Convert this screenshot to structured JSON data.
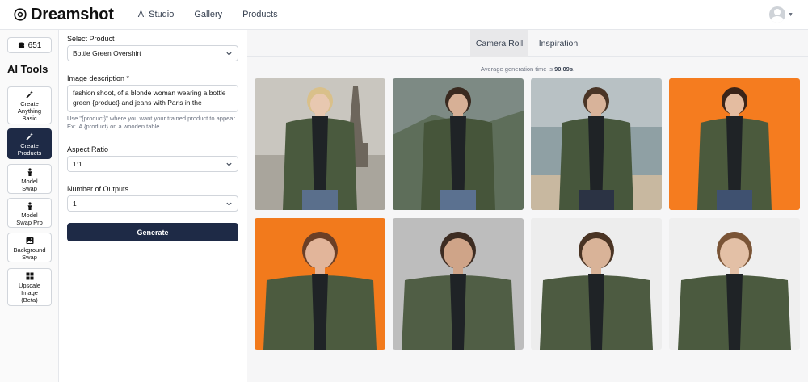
{
  "brand": {
    "name": "Dreamshot"
  },
  "nav": {
    "items": [
      "AI Studio",
      "Gallery",
      "Products"
    ]
  },
  "sidebar": {
    "credits": "651",
    "title": "AI Tools",
    "tools": [
      {
        "label": "Create\nAnything\nBasic",
        "icon": "magic-wand-icon",
        "active": false
      },
      {
        "label": "Create\nProducts",
        "icon": "magic-wand-icon",
        "active": true
      },
      {
        "label": "Model\nSwap",
        "icon": "person-icon",
        "active": false
      },
      {
        "label": "Model\nSwap Pro",
        "icon": "person-icon",
        "active": false
      },
      {
        "label": "Background\nSwap",
        "icon": "image-icon",
        "active": false
      },
      {
        "label": "Upscale\nImage\n(Beta)",
        "icon": "grid-icon",
        "active": false
      }
    ]
  },
  "form": {
    "product_label": "Select Product",
    "product_value": "Bottle Green Overshirt",
    "description_label": "Image description *",
    "description_value": "fashion shoot, of a blonde woman wearing a bottle green {product} and jeans with Paris in the",
    "hint": "Use \"{product}\" where you want your trained product to appear. Ex: 'A {product} on a wooden table.",
    "aspect_label": "Aspect Ratio",
    "aspect_value": "1:1",
    "outputs_label": "Number of Outputs",
    "outputs_value": "1",
    "generate_label": "Generate"
  },
  "gallery": {
    "tabs": [
      "Camera Roll",
      "Inspiration"
    ],
    "active_tab": "Camera Roll",
    "avg_prefix": "Average generation time is ",
    "avg_time": "90.09s",
    "avg_suffix": ".",
    "images": [
      {
        "name": "photo-woman-paris",
        "bg": "#c9c6bf",
        "skin": "#e8c8b0",
        "hair": "#d9c08a",
        "jacket": "#4a5a3e",
        "pants": "#5a6f8c"
      },
      {
        "name": "photo-man-mountains",
        "bg": "#7d8a84",
        "skin": "#d7b096",
        "hair": "#3a2a20",
        "jacket": "#46553a",
        "pants": "#5b7190"
      },
      {
        "name": "photo-man-beach",
        "bg": "#b8c1c4",
        "skin": "#d8b39a",
        "hair": "#4a3526",
        "jacket": "#47573c",
        "pants": "#2b3344"
      },
      {
        "name": "photo-woman-orange",
        "bg": "#f57c1f",
        "skin": "#e4bca0",
        "hair": "#3b2418",
        "jacket": "#4b5a3d",
        "pants": "#3f5170"
      },
      {
        "name": "photo-woman-orange-closeup",
        "bg": "#f27a1c",
        "skin": "#e2b59a",
        "hair": "#6b3f26",
        "jacket": "#4c5b3f",
        "pants": "#4c5b3f"
      },
      {
        "name": "photo-man-closeup-grey",
        "bg": "#bdbdbd",
        "skin": "#cfa488",
        "hair": "#3d2c22",
        "jacket": "#505e45",
        "pants": "#505e45"
      },
      {
        "name": "photo-man-white",
        "bg": "#ededed",
        "skin": "#d9b398",
        "hair": "#4a3424",
        "jacket": "#4d5b41",
        "pants": "#4d5b41"
      },
      {
        "name": "photo-woman-white",
        "bg": "#efefef",
        "skin": "#e3c0a6",
        "hair": "#7a5436",
        "jacket": "#4b5a3f",
        "pants": "#4b5a3f"
      }
    ]
  }
}
